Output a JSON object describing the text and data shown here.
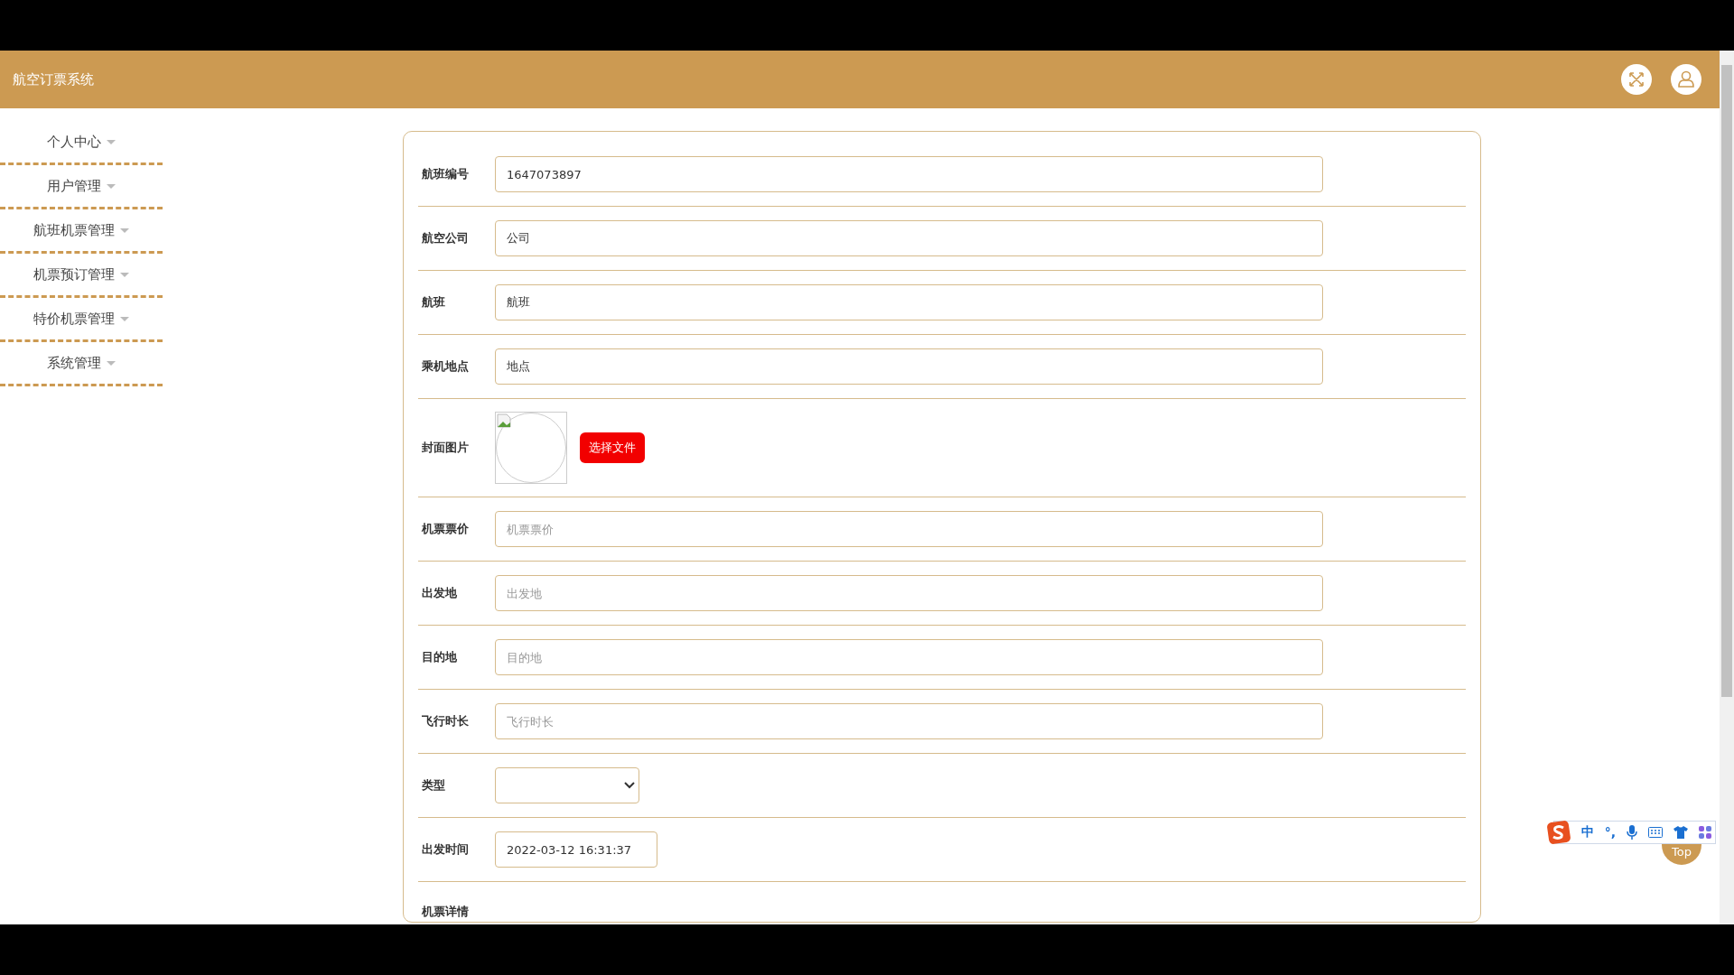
{
  "header": {
    "title": "航空订票系统"
  },
  "sidebar": {
    "items": [
      {
        "label": "个人中心"
      },
      {
        "label": "用户管理"
      },
      {
        "label": "航班机票管理"
      },
      {
        "label": "机票预订管理"
      },
      {
        "label": "特价机票管理"
      },
      {
        "label": "系统管理"
      }
    ]
  },
  "form": {
    "fields": [
      {
        "kind": "text",
        "label": "航班编号",
        "value": "1647073897"
      },
      {
        "kind": "text",
        "label": "航空公司",
        "value": "公司"
      },
      {
        "kind": "text",
        "label": "航班",
        "value": "航班"
      },
      {
        "kind": "text",
        "label": "乘机地点",
        "value": "地点"
      },
      {
        "kind": "image",
        "label": "封面图片",
        "button": "选择文件"
      },
      {
        "kind": "text",
        "label": "机票票价",
        "placeholder": "机票票价"
      },
      {
        "kind": "text",
        "label": "出发地",
        "placeholder": "出发地"
      },
      {
        "kind": "text",
        "label": "目的地",
        "placeholder": "目的地"
      },
      {
        "kind": "text",
        "label": "飞行时长",
        "placeholder": "飞行时长"
      },
      {
        "kind": "select",
        "label": "类型"
      },
      {
        "kind": "date",
        "label": "出发时间",
        "value": "2022-03-12 16:31:37"
      },
      {
        "kind": "editor",
        "label": "机票详情"
      }
    ]
  },
  "back_to_top": {
    "label": "Top"
  },
  "ime_toolbar": {
    "items": [
      "中",
      "°,"
    ]
  }
}
